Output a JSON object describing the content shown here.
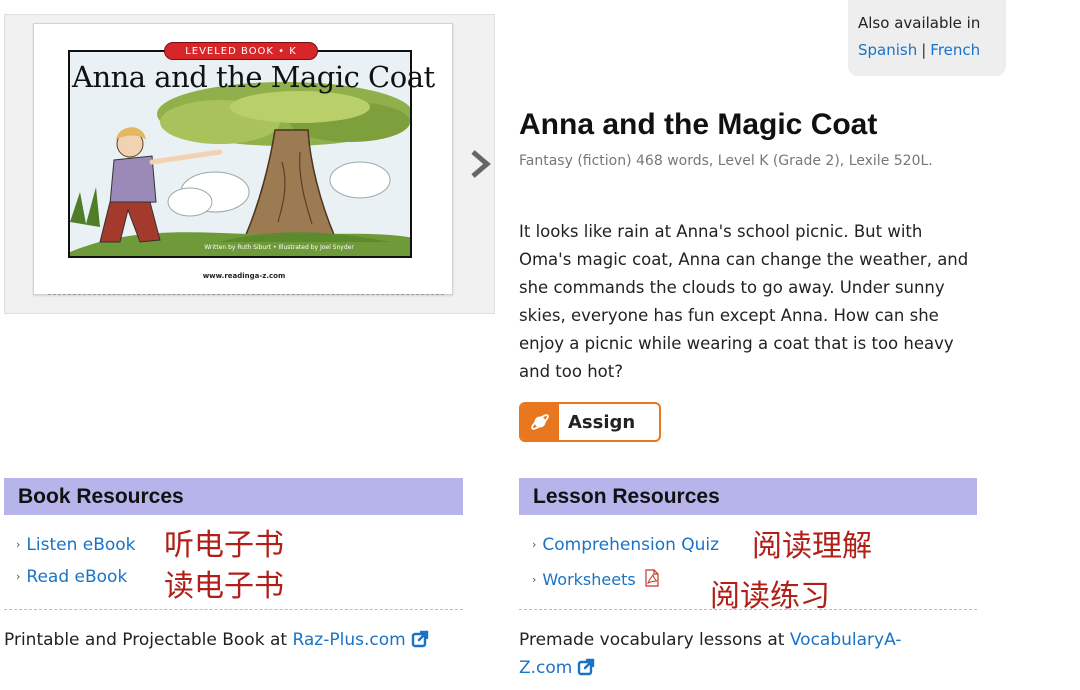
{
  "cover": {
    "level_banner": "LEVELED BOOK • K",
    "title": "Anna and the Magic Coat",
    "credit": "Written by Ruth Siburt • Illustrated by Joel Snyder",
    "url": "www.readinga-z.com"
  },
  "also_available": {
    "label": "Also available in",
    "languages": [
      "Spanish",
      "French"
    ],
    "separator": "|"
  },
  "book": {
    "title": "Anna and the Magic Coat",
    "meta": "Fantasy (fiction) 468 words, Level K (Grade 2), Lexile 520L.",
    "description": "It looks like rain at Anna's school picnic. But with Oma's magic coat, Anna can change the weather, and she commands the clouds to go away. Under sunny skies, everyone has fun except Anna. How can she enjoy a picnic while wearing a coat that is too heavy and too hot?"
  },
  "assign": {
    "label": "Assign"
  },
  "book_resources": {
    "heading": "Book Resources",
    "items": [
      {
        "label": "Listen eBook",
        "annotation": "听电子书"
      },
      {
        "label": "Read eBook",
        "annotation": "读电子书"
      }
    ],
    "footer_text": "Printable and Projectable Book at ",
    "footer_link": "Raz-Plus.com"
  },
  "lesson_resources": {
    "heading": "Lesson Resources",
    "items": [
      {
        "label": "Comprehension Quiz",
        "annotation": "阅读理解"
      },
      {
        "label": "Worksheets",
        "annotation": "阅读练习"
      }
    ],
    "footer_text": "Premade vocabulary lessons at ",
    "footer_link": "VocabularyA-Z.com"
  },
  "colors": {
    "link": "#1a73c7",
    "section_header": "#b7b4ec",
    "assign_accent": "#e8771f",
    "annotation_red": "#b01f18"
  },
  "icons": [
    "chevron-right-icon",
    "saturn-icon",
    "pdf-icon",
    "external-link-icon"
  ]
}
